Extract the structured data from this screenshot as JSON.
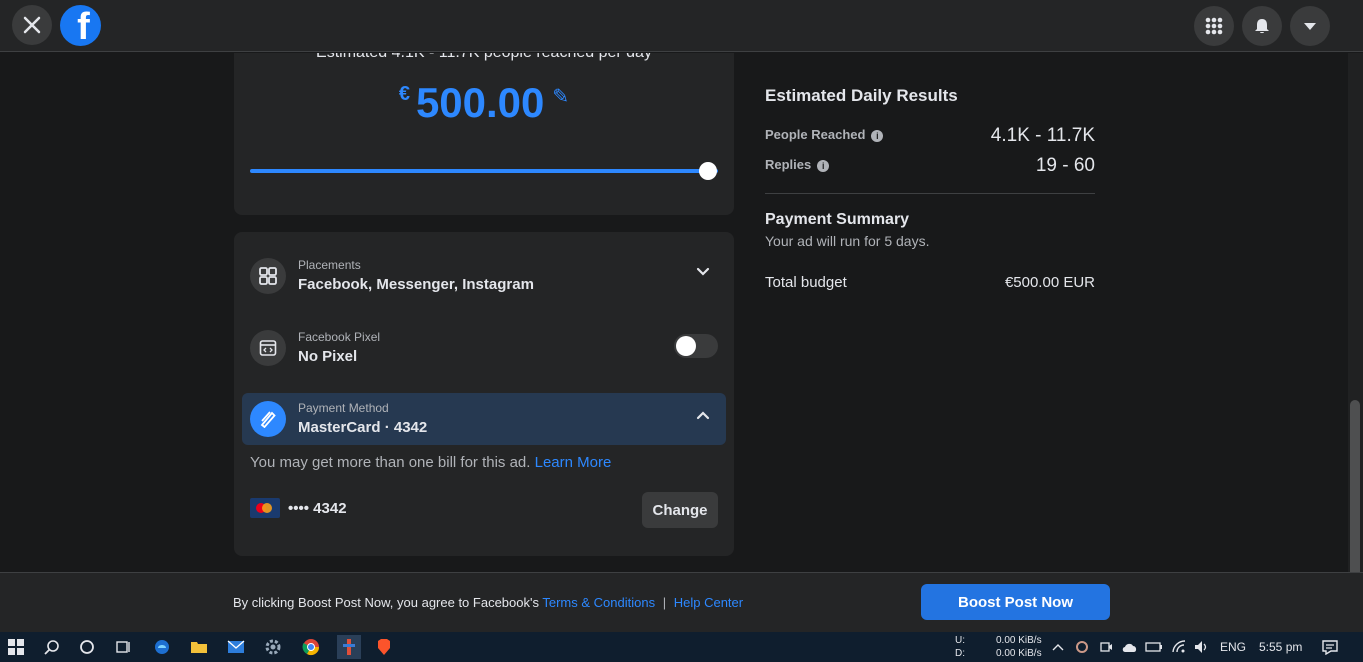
{
  "header": {
    "close_icon": "close-icon",
    "logo_letter": "f",
    "menu_icon": "grid-menu-icon",
    "notifications_icon": "bell-icon",
    "account_icon": "caret-down-icon"
  },
  "budget": {
    "reach_text": "Estimated 4.1K - 11.7K people reached per day",
    "currency_symbol": "€",
    "amount": "500.00",
    "slider_level": 1.0
  },
  "settings": {
    "placements_label": "Placements",
    "placements_value": "Facebook, Messenger, Instagram",
    "pixel_label": "Facebook Pixel",
    "pixel_value": "No Pixel",
    "pixel_toggle_on": false,
    "payment_label": "Payment Method",
    "payment_value": "MasterCard · 4342",
    "note_text": "You may get more than one bill for this ad.",
    "learn_more": "Learn More",
    "card_number": "•••• 4342",
    "change_label": "Change"
  },
  "results": {
    "title": "Estimated Daily Results",
    "people_reached_label": "People Reached",
    "people_reached_value": "4.1K - 11.7K",
    "replies_label": "Replies",
    "replies_value": "19 - 60"
  },
  "payment_summary": {
    "title": "Payment Summary",
    "subtitle": "Your ad will run for 5 days.",
    "total_label": "Total budget",
    "total_value": "€500.00 EUR"
  },
  "footer": {
    "agree_text": "By clicking Boost Post Now, you agree to Facebook's",
    "terms_link": "Terms & Conditions",
    "separator": "|",
    "help_link": "Help Center",
    "boost_button": "Boost Post Now"
  },
  "taskbar": {
    "upload_label": "U:",
    "download_label": "D:",
    "upload_speed": "0.00 KiB/s",
    "download_speed": "0.00 KiB/s",
    "language": "ENG",
    "time": "5:55 pm"
  }
}
